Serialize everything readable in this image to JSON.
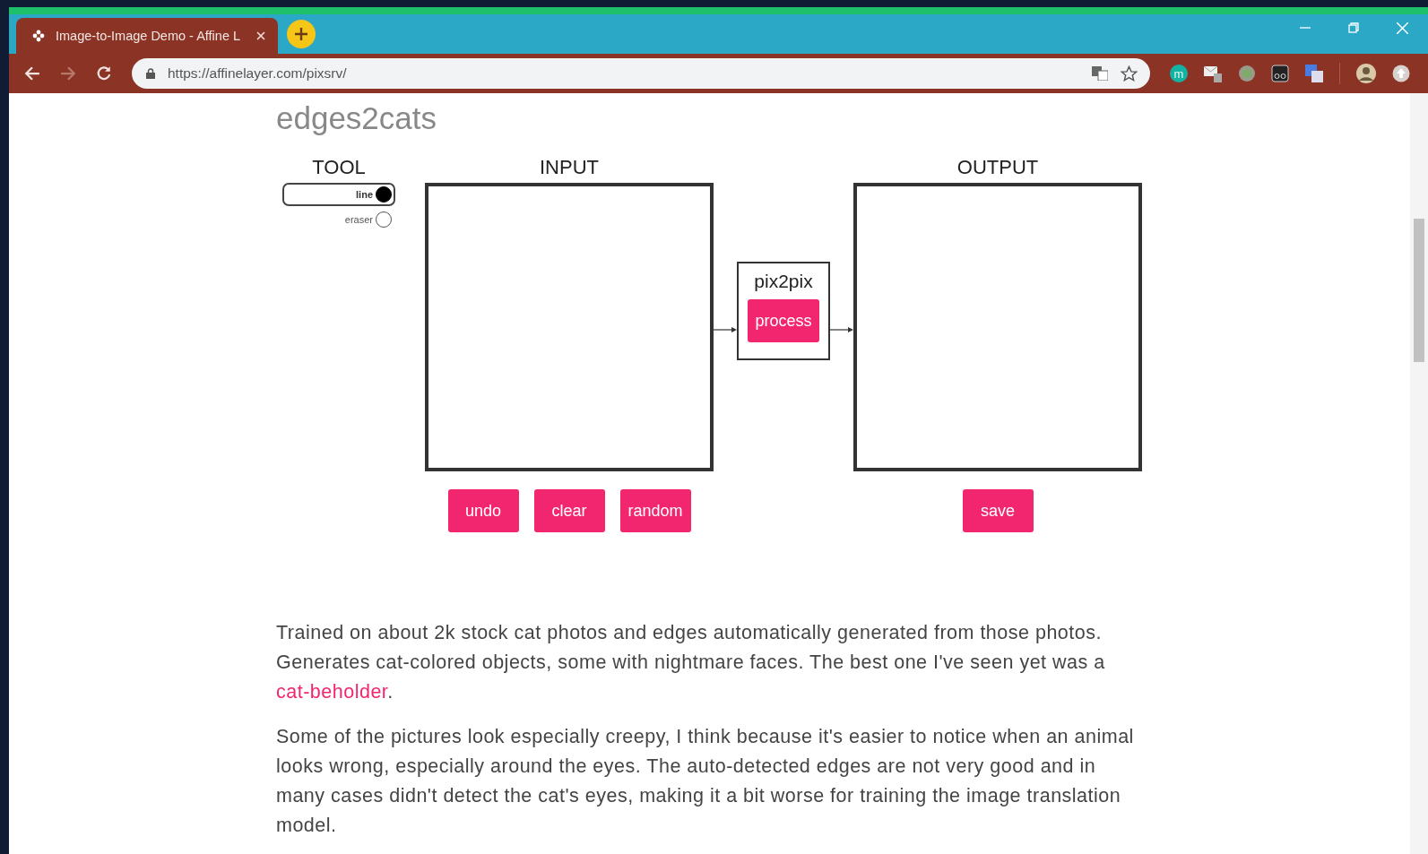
{
  "browser": {
    "tab": {
      "title": "Image-to-Image Demo - Affine L",
      "selected": true
    },
    "url": "https://affinelayer.com/pixsrv/",
    "extension_label": "m"
  },
  "page": {
    "title": "edges2cats",
    "tool": {
      "heading": "TOOL",
      "options": [
        {
          "label": "line",
          "selected": true
        },
        {
          "label": "eraser",
          "selected": false
        }
      ]
    },
    "input": {
      "heading": "INPUT",
      "buttons": [
        "undo",
        "clear",
        "random"
      ]
    },
    "model": {
      "title": "pix2pix",
      "button": "process"
    },
    "output": {
      "heading": "OUTPUT",
      "buttons": [
        "save"
      ]
    },
    "paragraphs": [
      {
        "text": "Trained on about 2k stock cat photos and edges automatically generated from those photos. Generates cat-colored objects, some with nightmare faces. The best one I've seen yet was a ",
        "link": "cat-beholder",
        "after": "."
      },
      {
        "text": "Some of the pictures look especially creepy, I think because it's easier to notice when an animal looks wrong, especially around the eyes. The auto-detected edges are not very good and in many cases didn't detect the cat's eyes, making it a bit worse for training the image translation model."
      }
    ]
  }
}
